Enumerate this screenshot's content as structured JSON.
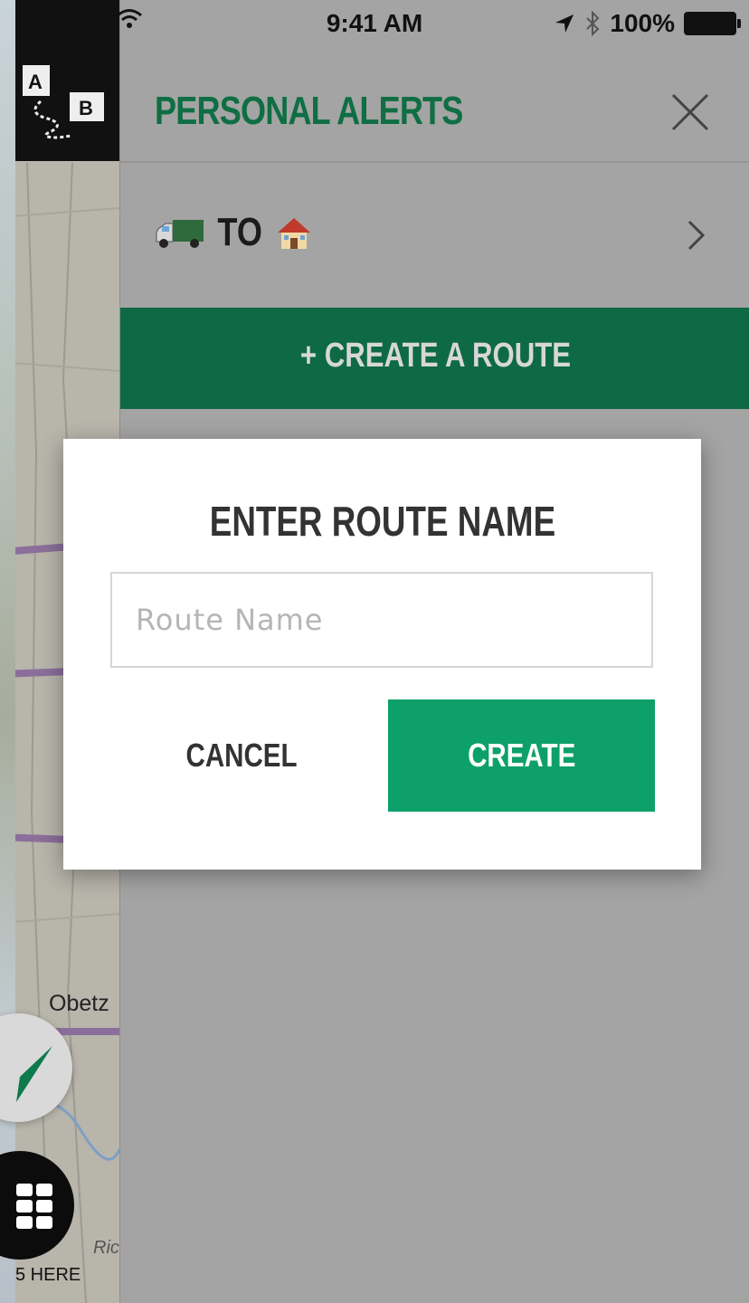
{
  "status_bar": {
    "time": "9:41 AM",
    "battery": "100%"
  },
  "map": {
    "place_label": "Obetz",
    "attribution": "5 HERE",
    "partial_label": "Ric"
  },
  "panel": {
    "title": "PERSONAL ALERTS",
    "route": {
      "label": "TO",
      "from_icon": "truck-emoji",
      "to_icon": "house-emoji"
    },
    "create_route_label": "+ CREATE A ROUTE"
  },
  "modal": {
    "title": "ENTER ROUTE NAME",
    "input_placeholder": "Route Name",
    "input_value": "",
    "cancel_label": "CANCEL",
    "create_label": "CREATE"
  },
  "colors": {
    "brand_green": "#0f6e43",
    "create_button": "#0ea06b",
    "overlay_gray": "#a4a4a4"
  }
}
